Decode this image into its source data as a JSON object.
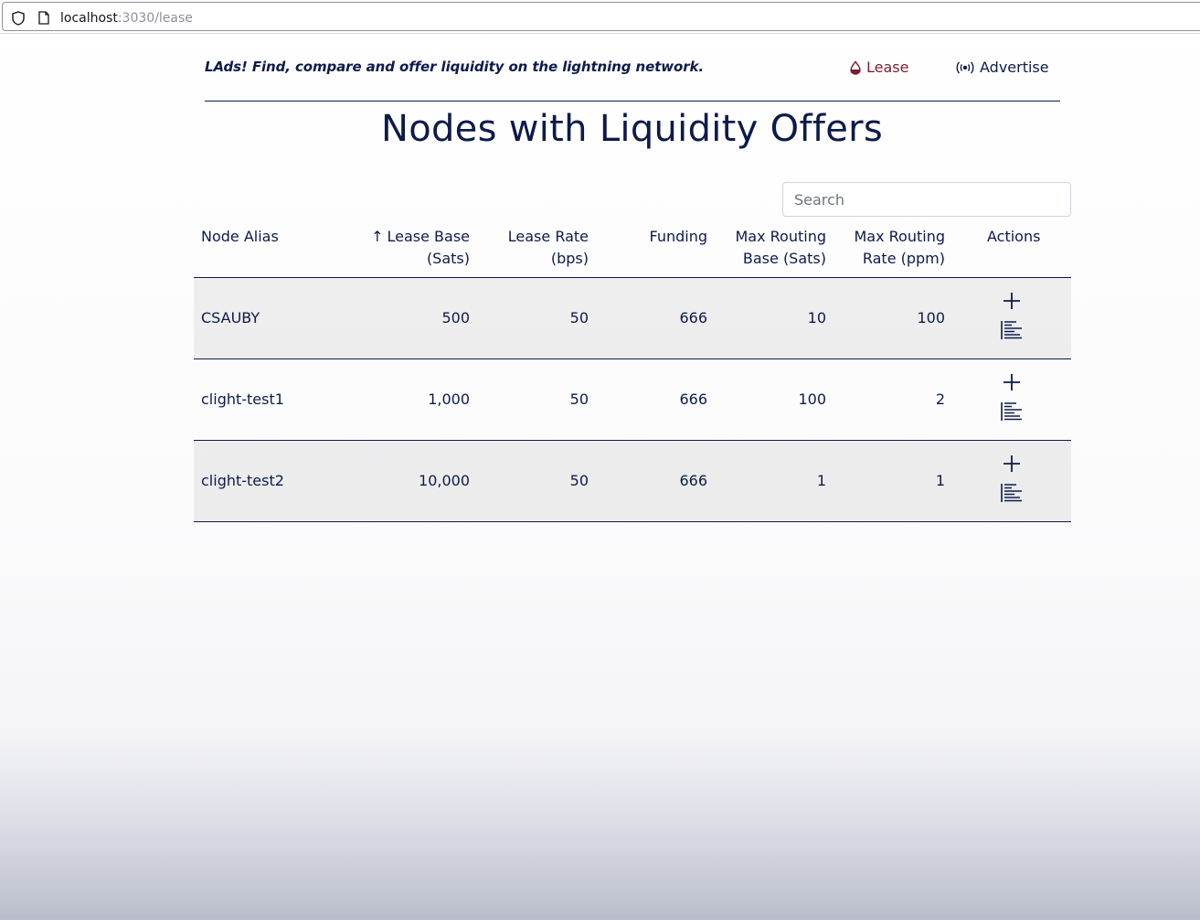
{
  "browser": {
    "url_host": "localhost",
    "url_path": ":3030/lease"
  },
  "header": {
    "tagline": "LAds! Find, compare and offer liquidity on the lightning network.",
    "nav": {
      "lease_label": "Lease",
      "advertise_label": "Advertise"
    },
    "colors": {
      "primary": "#0d1b4b",
      "active_nav": "#7a1d33"
    }
  },
  "main": {
    "title": "Nodes with Liquidity Offers",
    "search": {
      "placeholder": "Search",
      "value": ""
    },
    "table": {
      "columns": {
        "alias": "Node Alias",
        "lease_base_line1": "Lease Base",
        "lease_base_line2": "(Sats)",
        "lease_rate_line1": "Lease Rate",
        "lease_rate_line2": "(bps)",
        "funding": "Funding",
        "max_routing_base_line1": "Max Routing",
        "max_routing_base_line2": "Base (Sats)",
        "max_routing_rate_line1": "Max Routing",
        "max_routing_rate_line2": "Rate (ppm)",
        "actions": "Actions"
      },
      "sort_indicator": "↑",
      "rows": [
        {
          "alias": "CSAUBY",
          "lease_base": "500",
          "lease_rate": "50",
          "funding": "666",
          "max_routing_base": "10",
          "max_routing_rate": "100"
        },
        {
          "alias": "clight-test1",
          "lease_base": "1,000",
          "lease_rate": "50",
          "funding": "666",
          "max_routing_base": "100",
          "max_routing_rate": "2"
        },
        {
          "alias": "clight-test2",
          "lease_base": "10,000",
          "lease_rate": "50",
          "funding": "666",
          "max_routing_base": "1",
          "max_routing_rate": "1"
        }
      ],
      "row_actions": [
        "plus-icon",
        "list-details-icon"
      ]
    }
  }
}
